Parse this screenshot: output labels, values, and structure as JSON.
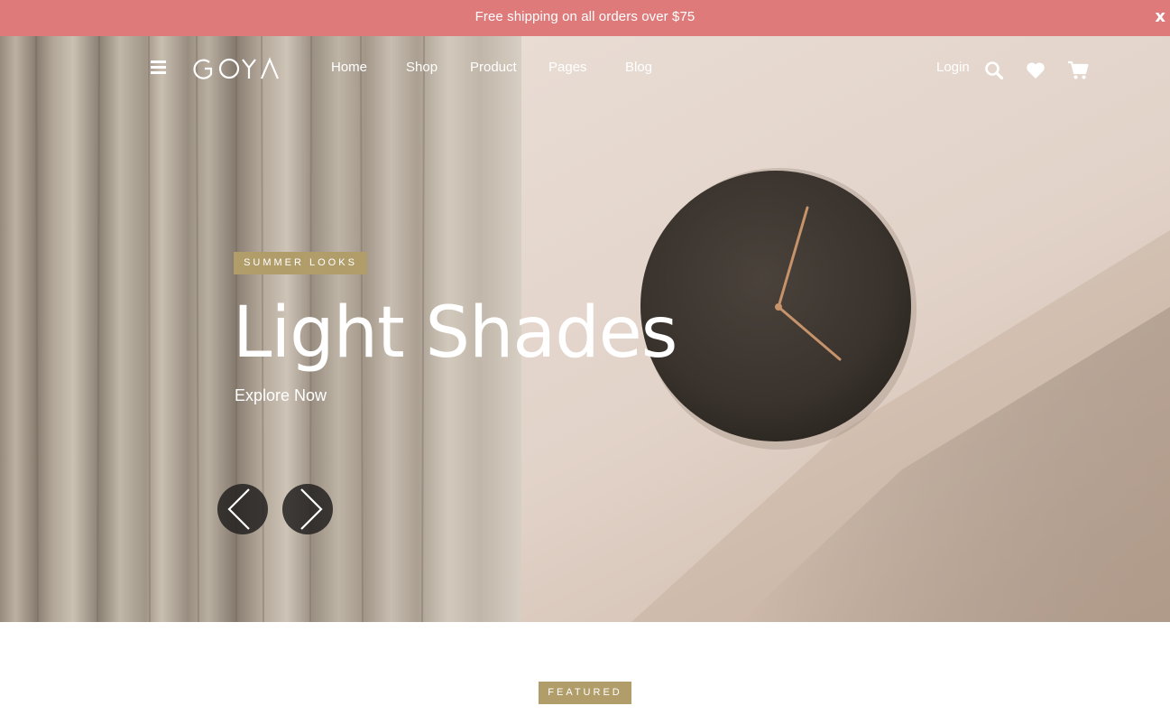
{
  "announcement": {
    "text": "Free shipping on all orders over $75",
    "close_label": "x"
  },
  "header": {
    "logo_text": "GOYA",
    "nav": [
      {
        "label": "Home"
      },
      {
        "label": "Shop"
      },
      {
        "label": "Product"
      },
      {
        "label": "Pages"
      },
      {
        "label": "Blog"
      }
    ],
    "login_label": "Login",
    "icons": [
      "menu-icon",
      "search-icon",
      "heart-icon",
      "cart-icon"
    ]
  },
  "hero": {
    "badge": "SUMMER LOOKS",
    "title": "Light Shades",
    "cta": "Explore Now",
    "prev_icon": "chevron-left-icon",
    "next_icon": "chevron-right-icon"
  },
  "featured": {
    "badge": "FEATURED"
  },
  "colors": {
    "announcement_bg": "#df7a7b",
    "badge_bg": "#b19d6a",
    "text_light": "#ffffff"
  }
}
